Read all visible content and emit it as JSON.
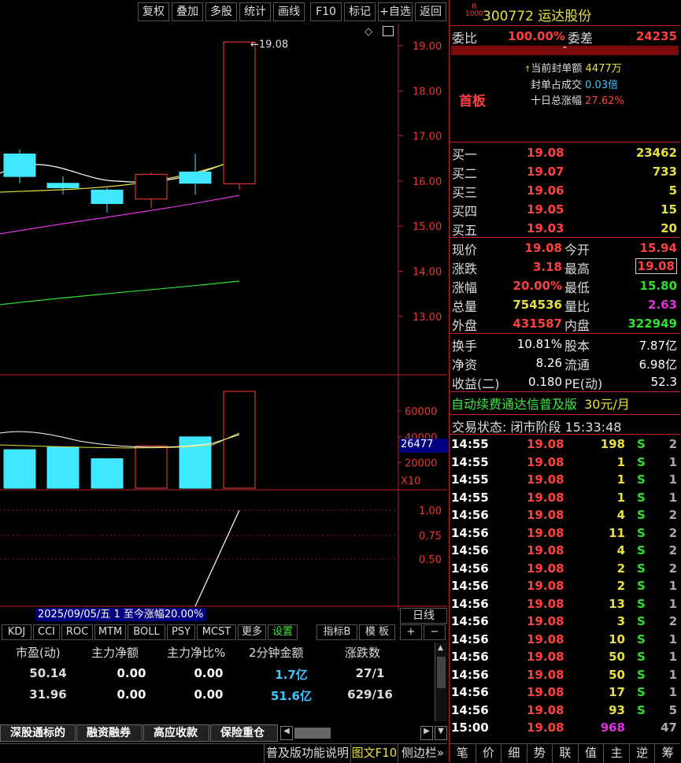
{
  "toolbar": {
    "buttons": [
      "复权",
      "叠加",
      "多股",
      "统计",
      "画线",
      "F10",
      "标记",
      "+自选",
      "返回"
    ]
  },
  "chart": {
    "price_labels": [
      "19.00",
      "18.00",
      "17.00",
      "16.00",
      "15.00",
      "14.00",
      "13.00"
    ],
    "high_label": "19.08",
    "volume_labels": [
      "60000",
      "40000",
      "20000"
    ],
    "volume_current": "26477",
    "volume_unit": "X10",
    "ind_labels": [
      "1.00",
      "0.75",
      "0.50"
    ],
    "info_bar": "2025/09/05/五 1 至今涨幅20.00%",
    "period": "日线",
    "candles": [
      {
        "o": 16.1,
        "c": 16.6,
        "h": 16.7,
        "l": 15.95,
        "up": false
      },
      {
        "o": 15.95,
        "c": 15.85,
        "h": 16.1,
        "l": 15.7,
        "up": false
      },
      {
        "o": 15.8,
        "c": 15.5,
        "h": 15.85,
        "l": 15.3,
        "up": false
      },
      {
        "o": 15.6,
        "c": 16.15,
        "h": 16.2,
        "l": 15.4,
        "up": true
      },
      {
        "o": 15.95,
        "c": 16.2,
        "h": 16.6,
        "l": 15.7,
        "up": false
      },
      {
        "o": 15.94,
        "c": 19.08,
        "h": 19.08,
        "l": 15.8,
        "up": true
      }
    ],
    "volumes": [
      {
        "v": 30000,
        "up": false
      },
      {
        "v": 32000,
        "up": false
      },
      {
        "v": 23000,
        "up": false
      },
      {
        "v": 33000,
        "up": true
      },
      {
        "v": 40000,
        "up": false
      },
      {
        "v": 75450,
        "up": true
      }
    ]
  },
  "indicator_tabs": [
    "KDJ",
    "CCI",
    "ROC",
    "MTM",
    "BOLL",
    "PSY",
    "MCST",
    "更多",
    "设置",
    "指标B",
    "模 板",
    "+",
    "−"
  ],
  "stats_table": {
    "headers": [
      "市盈(动)",
      "主力净额",
      "主力净比%",
      "2分钟金额",
      "涨跌数"
    ],
    "rows": [
      [
        "50.14",
        "0.00",
        "0.00",
        "1.7亿",
        "27/1"
      ],
      [
        "31.96",
        "0.00",
        "0.00",
        "51.6亿",
        "629/16"
      ]
    ]
  },
  "bottom_tabs": [
    "深股通标的",
    "融资融券",
    "高应收款",
    "保险重仓"
  ],
  "bottom_bar": [
    "普及版功能说明",
    "图文F10",
    "侧边栏»"
  ],
  "right_tabs": [
    "笔",
    "价",
    "细",
    "势",
    "联",
    "值",
    "主",
    "逆",
    "筹"
  ],
  "stock": {
    "badge_top": "R",
    "badge_bottom": "1000",
    "code": "300772",
    "name": "运达股份"
  },
  "weibi": {
    "label": "委比",
    "value": "100.00%",
    "label2": "委差",
    "value2": "24235"
  },
  "seal": {
    "tag": "首板",
    "items": [
      {
        "label": "当前封单额",
        "value": "4477万"
      },
      {
        "label": "封单占成交",
        "value": "0.03倍"
      },
      {
        "label": "十日总涨幅",
        "value": "27.62%"
      }
    ]
  },
  "bids": [
    {
      "label": "买一",
      "price": "19.08",
      "vol": "23462"
    },
    {
      "label": "买二",
      "price": "19.07",
      "vol": "733"
    },
    {
      "label": "买三",
      "price": "19.06",
      "vol": "5"
    },
    {
      "label": "买四",
      "price": "19.05",
      "vol": "15"
    },
    {
      "label": "买五",
      "price": "19.03",
      "vol": "20"
    }
  ],
  "quote": [
    {
      "l1": "现价",
      "v1": "19.08",
      "l2": "今开",
      "v2": "15.94"
    },
    {
      "l1": "涨跌",
      "v1": "3.18",
      "l2": "最高",
      "v2": "19.08"
    },
    {
      "l1": "涨幅",
      "v1": "20.00%",
      "l2": "最低",
      "v2": "15.80"
    },
    {
      "l1": "总量",
      "v1": "754536",
      "l2": "量比",
      "v2": "2.63"
    },
    {
      "l1": "外盘",
      "v1": "431587",
      "l2": "内盘",
      "v2": "322949"
    }
  ],
  "fund": [
    {
      "l1": "换手",
      "v1": "10.81%",
      "l2": "股本",
      "v2": "7.87亿"
    },
    {
      "l1": "净资",
      "v1": "8.26",
      "l2": "流通",
      "v2": "6.98亿"
    },
    {
      "l1": "收益(二)",
      "v1": "0.180",
      "l2": "PE(动)",
      "v2": "52.3"
    }
  ],
  "promo": {
    "text": "自动续费通达信普及版",
    "price": "30元/月"
  },
  "status": {
    "text": "交易状态: 闭市阶段 15:33:48"
  },
  "ticks": [
    [
      "14:55",
      "19.08",
      "198",
      "S",
      "2"
    ],
    [
      "14:55",
      "19.08",
      "1",
      "S",
      "1"
    ],
    [
      "14:55",
      "19.08",
      "1",
      "S",
      "1"
    ],
    [
      "14:55",
      "19.08",
      "1",
      "S",
      "1"
    ],
    [
      "14:56",
      "19.08",
      "4",
      "S",
      "2"
    ],
    [
      "14:56",
      "19.08",
      "11",
      "S",
      "2"
    ],
    [
      "14:56",
      "19.08",
      "4",
      "S",
      "2"
    ],
    [
      "14:56",
      "19.08",
      "2",
      "S",
      "2"
    ],
    [
      "14:56",
      "19.08",
      "2",
      "S",
      "1"
    ],
    [
      "14:56",
      "19.08",
      "13",
      "S",
      "1"
    ],
    [
      "14:56",
      "19.08",
      "3",
      "S",
      "2"
    ],
    [
      "14:56",
      "19.08",
      "10",
      "S",
      "1"
    ],
    [
      "14:56",
      "19.08",
      "50",
      "S",
      "1"
    ],
    [
      "14:56",
      "19.08",
      "50",
      "S",
      "1"
    ],
    [
      "14:56",
      "19.08",
      "17",
      "S",
      "1"
    ],
    [
      "14:56",
      "19.08",
      "93",
      "S",
      "5"
    ],
    [
      "15:00",
      "19.08",
      "968",
      "",
      "47"
    ]
  ]
}
